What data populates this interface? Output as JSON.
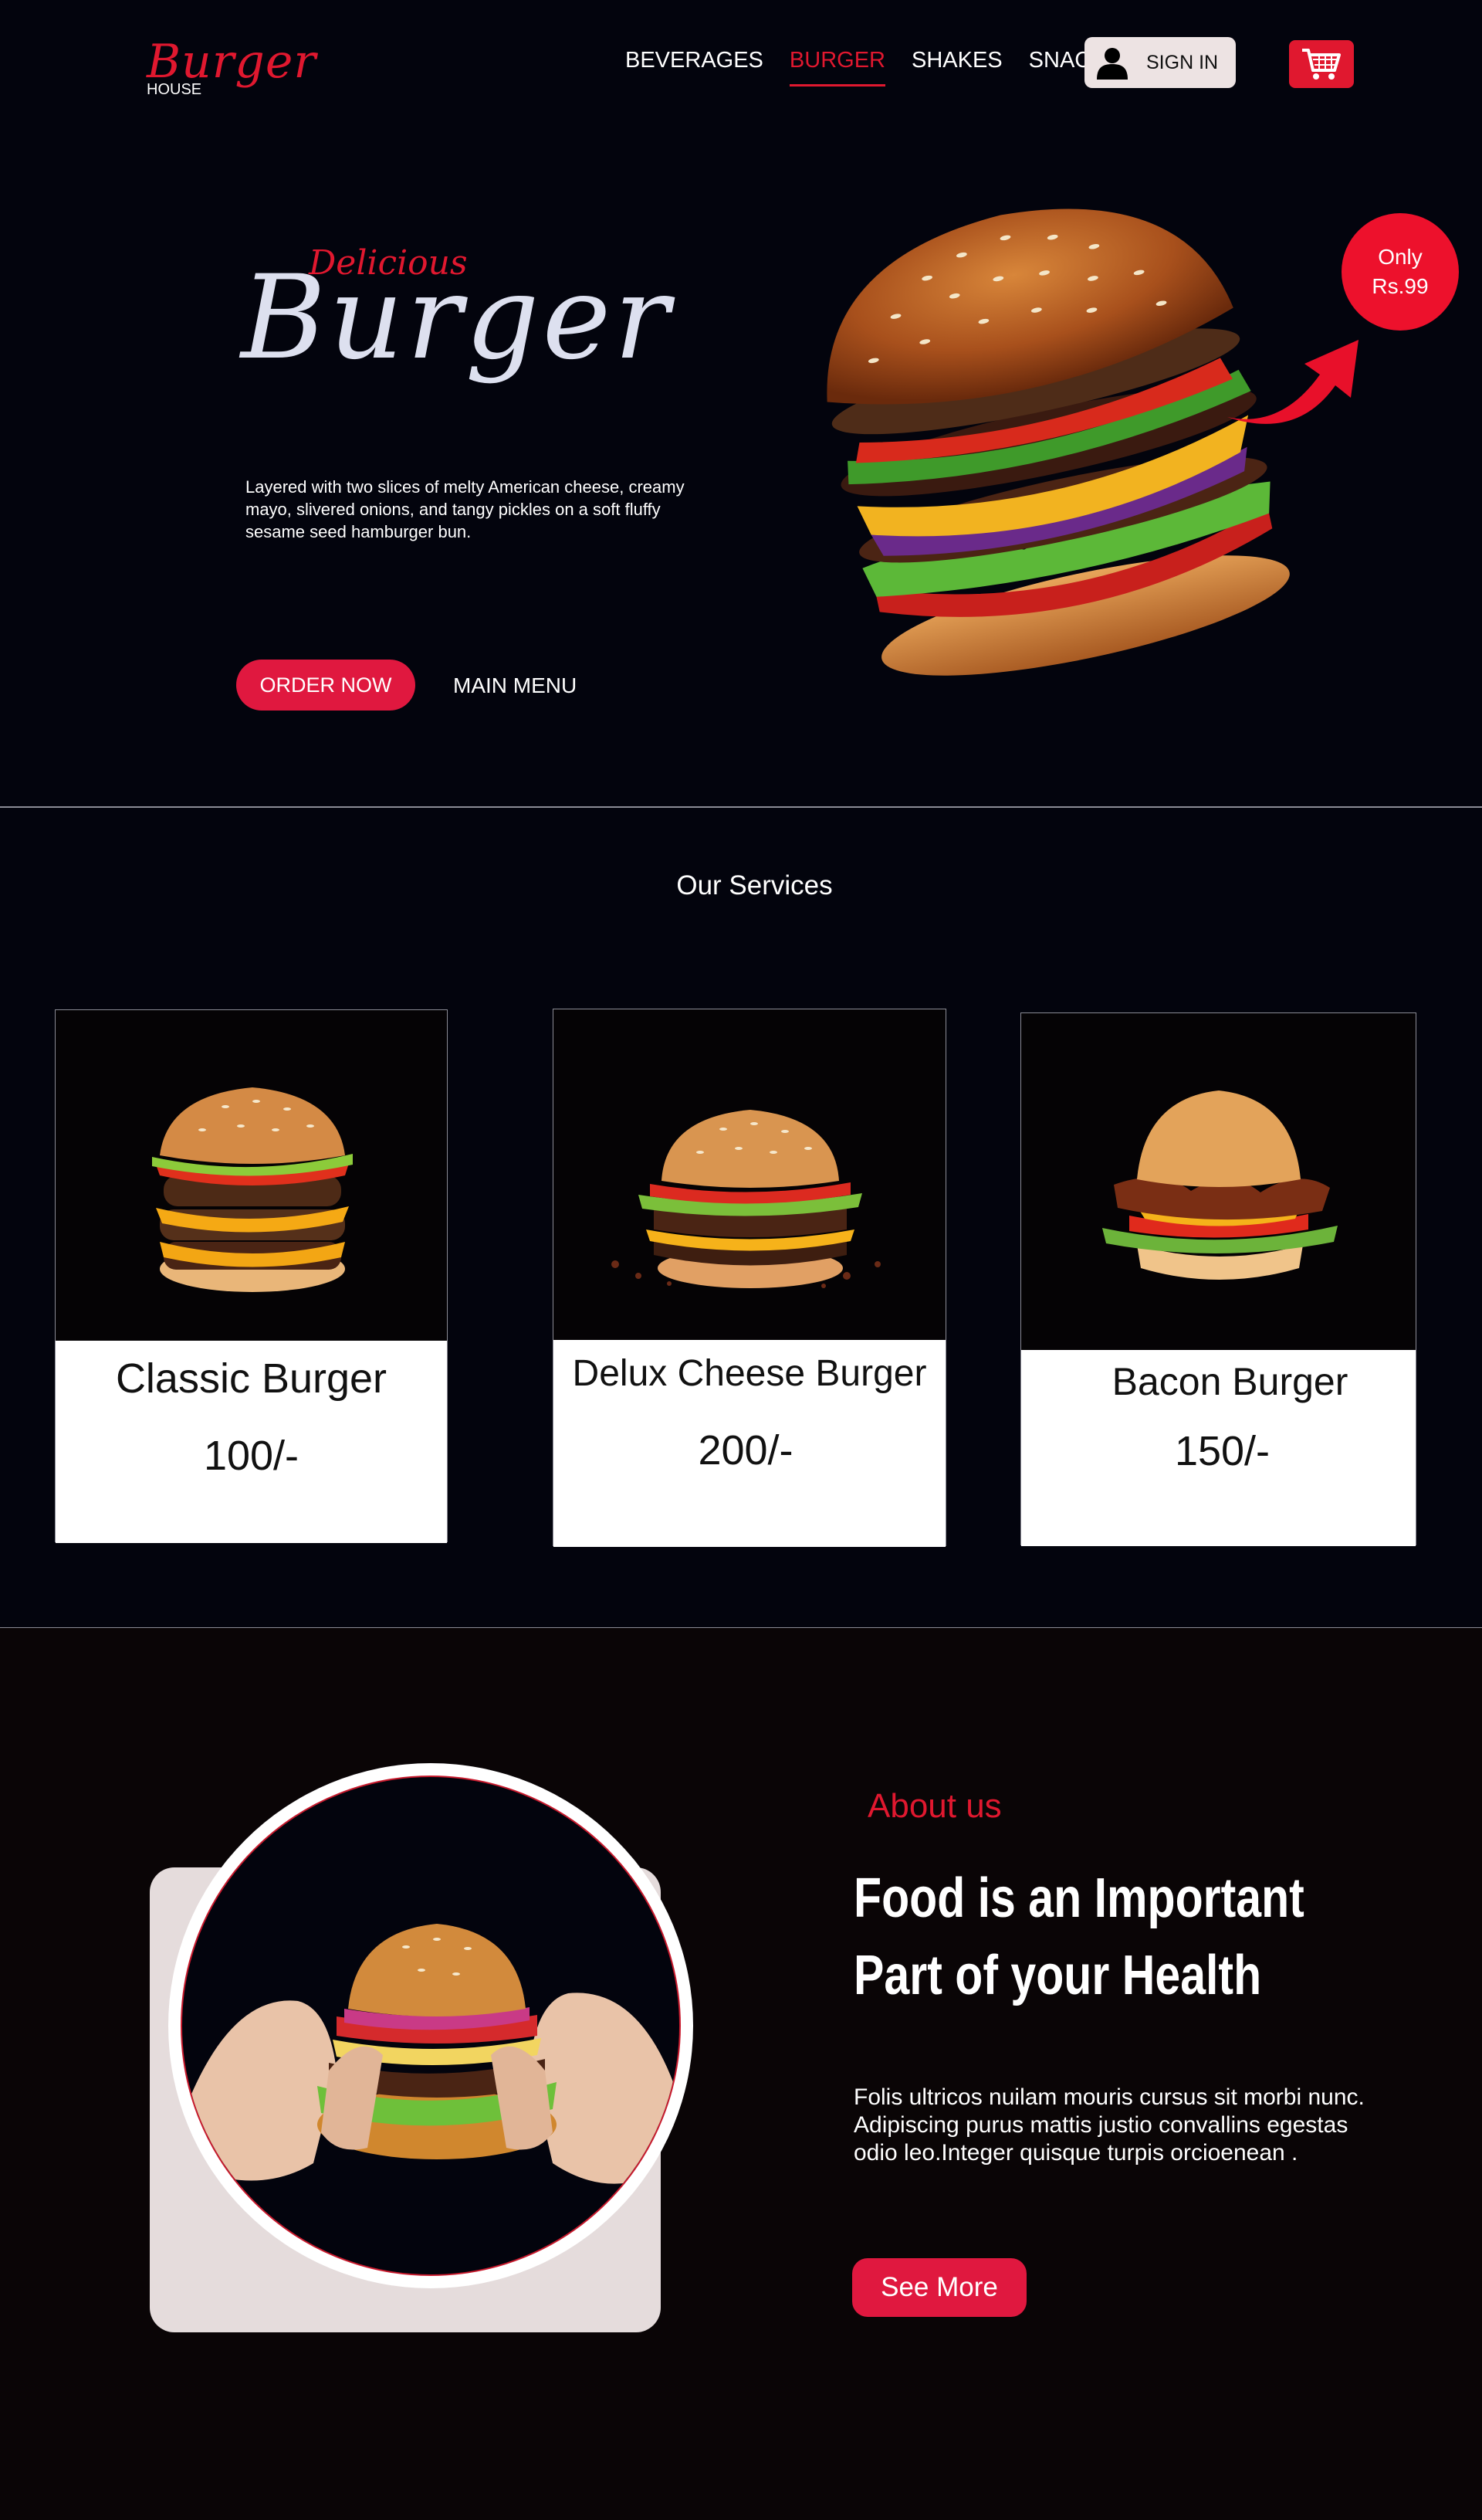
{
  "brand": {
    "name": "Burger",
    "tagline": "HOUSE",
    "accent": "#e0182f"
  },
  "nav": {
    "items": [
      {
        "label": "BEVERAGES",
        "active": false
      },
      {
        "label": "BURGER",
        "active": true
      },
      {
        "label": "SHAKES",
        "active": false
      },
      {
        "label": "SNACKS",
        "active": false
      }
    ],
    "signin_label": "SIGN IN",
    "user_icon": "user-icon",
    "cart_icon": "cart-icon"
  },
  "hero": {
    "kicker": "Delicious",
    "title": "Burger",
    "description": "Layered with two slices of melty American cheese, creamy mayo, slivered onions, and tangy pickles on a soft fluffy sesame seed hamburger bun.",
    "order_button": "ORDER NOW",
    "menu_link": "MAIN MENU",
    "price_line1": "Only",
    "price_line2": "Rs.99"
  },
  "services": {
    "title": "Our Services",
    "items": [
      {
        "name": "Classic Burger",
        "price": "100/-"
      },
      {
        "name": "Delux Cheese Burger",
        "price": "200/-"
      },
      {
        "name": "Bacon Burger",
        "price": "150/-"
      }
    ]
  },
  "about": {
    "kicker": "About us",
    "title": "Food is an Important Part of your Health",
    "description": "Folis  ultricos nuilam mouris cursus sit morbi nunc. Adipiscing purus mattis justio convallins egestas odio leo.Integer quisque turpis orcioenean .",
    "button": "See More"
  }
}
